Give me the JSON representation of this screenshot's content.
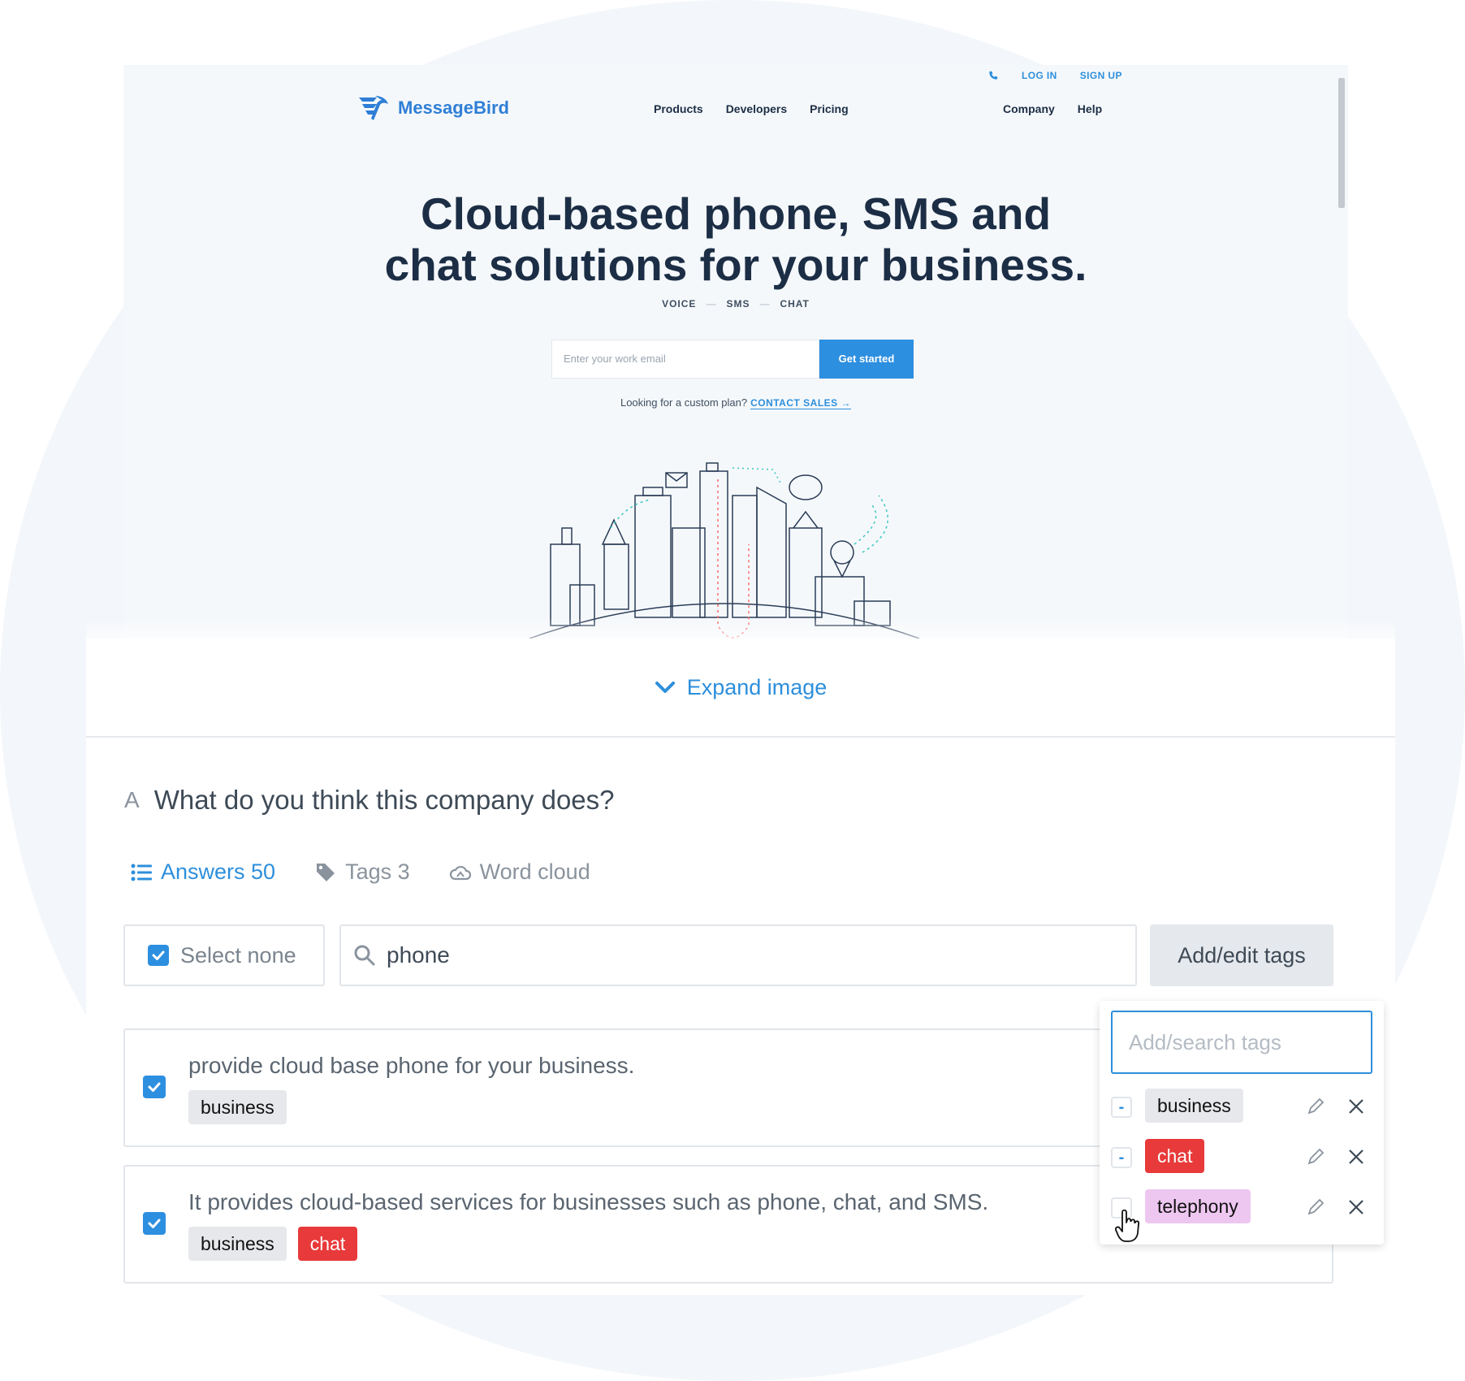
{
  "website": {
    "logo": "MessageBird",
    "top_links": [
      "LOG IN",
      "SIGN UP"
    ],
    "nav_left": [
      "Products",
      "Developers",
      "Pricing"
    ],
    "nav_right": [
      "Company",
      "Help"
    ],
    "hero_line1": "Cloud-based phone, SMS and",
    "hero_line2": "chat solutions for your business.",
    "sub_items": [
      "VOICE",
      "SMS",
      "CHAT"
    ],
    "email_placeholder": "Enter your work email",
    "cta": "Get started",
    "custom_text": "Looking for a custom plan?",
    "custom_link": "CONTACT SALES →"
  },
  "expand_label": "Expand image",
  "question": {
    "letter": "A",
    "text": "What do you think this company does?"
  },
  "tabs": [
    {
      "label": "Answers 50",
      "icon": "list-icon",
      "active": true
    },
    {
      "label": "Tags 3",
      "icon": "tag-icon",
      "active": false
    },
    {
      "label": "Word cloud",
      "icon": "cloud-icon",
      "active": false
    }
  ],
  "toolbar": {
    "select_none_label": "Select none",
    "search_value": "phone",
    "add_edit_label": "Add/edit tags"
  },
  "answers": [
    {
      "text": "provide cloud base phone for your business.",
      "checked": true,
      "tags": [
        "business"
      ]
    },
    {
      "text": "It provides cloud-based services for businesses such as phone, chat, and SMS.",
      "checked": true,
      "tags": [
        "business",
        "chat"
      ]
    }
  ],
  "tag_dropdown": {
    "placeholder": "Add/search tags",
    "tags": [
      {
        "name": "business",
        "state": "-",
        "color": "#e6e8eb"
      },
      {
        "name": "chat",
        "state": "-",
        "color": "#e83a3a"
      },
      {
        "name": "telephony",
        "state": "",
        "color": "#eec7f1"
      }
    ]
  },
  "colors": {
    "accent": "#2d8fdc",
    "chat_tag": "#e83a3a",
    "telephony_tag": "#eec7f1",
    "neutral_tag": "#e6e8eb"
  }
}
